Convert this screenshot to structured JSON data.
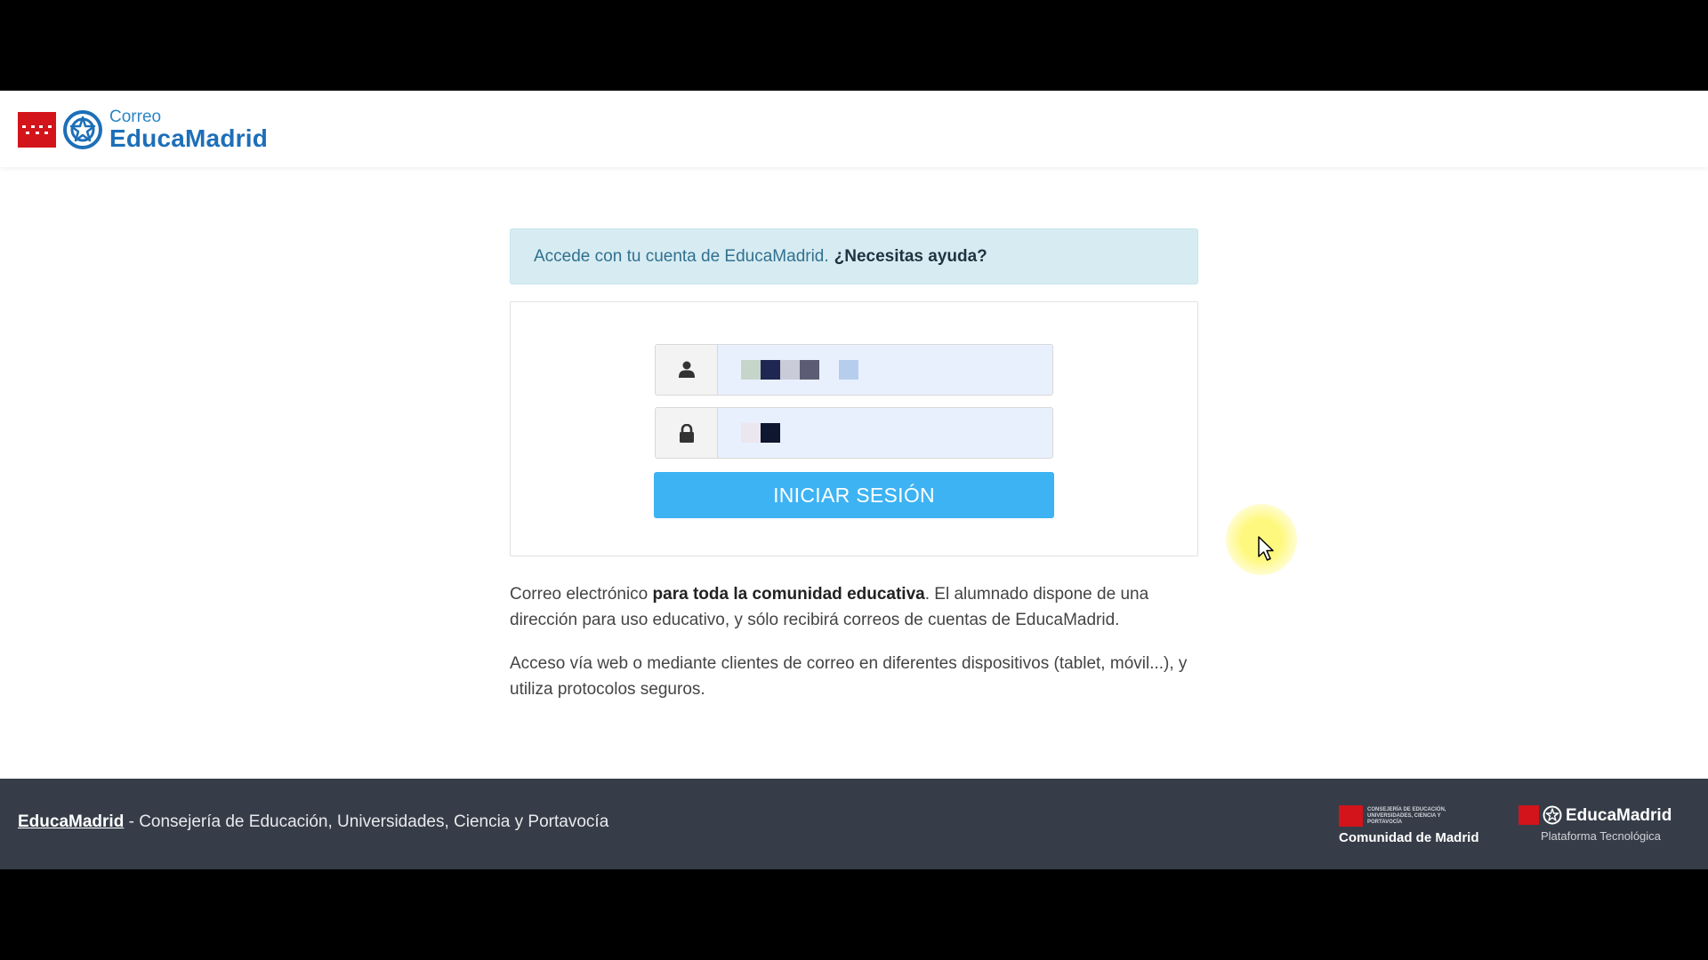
{
  "header": {
    "logo_small": "Correo",
    "logo_big": "EducaMadrid"
  },
  "alert": {
    "text": "Accede con tu cuenta de EducaMadrid.",
    "help_link": "¿Necesitas ayuda?"
  },
  "login": {
    "username_icon": "user-icon",
    "password_icon": "lock-icon",
    "button_label": "INICIAR SESIÓN"
  },
  "description": {
    "p1_a": "Correo electrónico ",
    "p1_b": "para toda la comunidad educativa",
    "p1_c": ". El alumnado dispone de una dirección para uso educativo, y sólo recibirá correos de cuentas de EducaMadrid.",
    "p2": "Acceso vía web o mediante clientes de correo en diferentes dispositivos (tablet, móvil...), y utiliza protocolos seguros."
  },
  "footer": {
    "link": "EducaMadrid",
    "text": " - Consejería de Educación, Universidades, Ciencia y Portavocía",
    "cm_small": "Consejería de Educación, Universidades, Ciencia y Portavocía",
    "cm_name": "Comunidad de Madrid",
    "em_name": "EducaMadrid",
    "em_sub": "Plataforma Tecnológica"
  },
  "colors": {
    "brand_blue": "#1d6fb8",
    "button_blue": "#3db3f3",
    "madrid_red": "#d3141b",
    "footer_bg": "#363d48",
    "alert_bg": "#d7ecf2"
  }
}
